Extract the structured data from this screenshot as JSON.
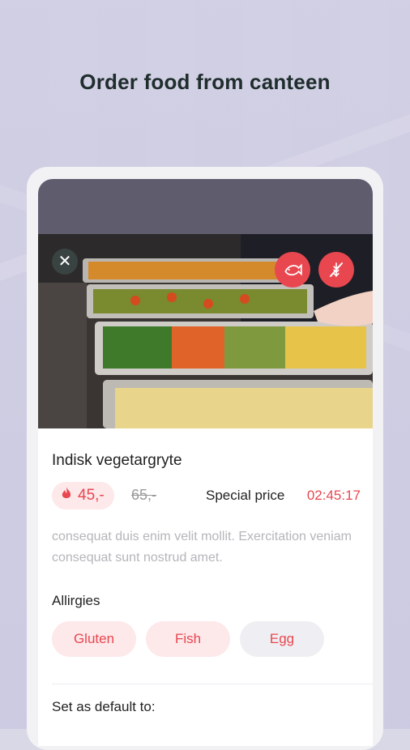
{
  "headline": "Order food from canteen",
  "dish": {
    "name": "Indisk vegetargryte",
    "price": "45,-",
    "old_price": "65,-",
    "special_label": "Special price",
    "countdown": "02:45:17",
    "description": "consequat duis enim velit mollit. Exercitation veniam consequat sunt nostrud amet."
  },
  "badges": [
    {
      "icon": "fish-icon"
    },
    {
      "icon": "no-gluten-icon"
    }
  ],
  "allergies": {
    "label": "Allirgies",
    "chips": [
      "Gluten",
      "Fish",
      "Egg"
    ]
  },
  "default_section": {
    "label": "Set as default to:"
  },
  "colors": {
    "accent": "#e8474f",
    "chip_bg": "#fde8ea",
    "chip_neutral_bg": "#efeff3",
    "header_band": "#5f5c6e"
  }
}
